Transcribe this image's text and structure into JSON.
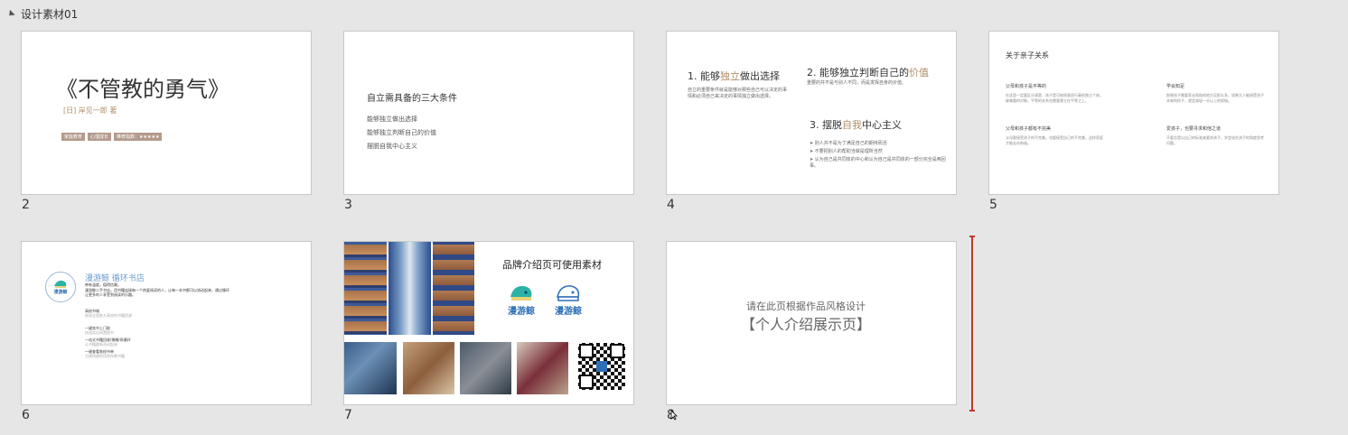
{
  "section": {
    "title": "设计素材01"
  },
  "slides": [
    {
      "number": "2",
      "title": "《不管教的勇气》",
      "author": "[日] 岸见一郎 著",
      "tags": [
        "家庭教育",
        "心理成长",
        "推荐指数：★★★★★"
      ]
    },
    {
      "number": "3",
      "title": "自立需具备的三大条件",
      "items": [
        "能够独立做出选择",
        "能够独立判断自己的价值",
        "摆脱自我中心主义"
      ]
    },
    {
      "number": "4",
      "point1": {
        "prefix": "1. 能够",
        "accent": "独立",
        "suffix": "做出选择",
        "body": "自立的重要条件就是能够对那些自己可以决定的事情和必须自己来决定的事情独立做出选择。"
      },
      "point2": {
        "prefix": "2. 能够独立判断自己的",
        "accent": "价值",
        "body": "重要的并不是与别人不同，而是发挥自身的价值。"
      },
      "point3": {
        "prefix": "3. 摆脱",
        "accent": "自我",
        "suffix": "中心主义",
        "bullets": [
          "别人并不是为了满足自己的期待而活",
          "不要把别人的帮助当做是理所当然",
          "认为自己是共同体的中心和认为自己是共同体的一部分完全是两回事。"
        ]
      }
    },
    {
      "number": "5",
      "title": "关于亲子关系",
      "blocks": [
        {
          "heading": "父母和孩子是平等的",
          "body": "在这里一定要区分清楚，孩子是可按照意愿行事的独立个体，被尊重的对象。平等的关系也需要建立在平等之上。"
        },
        {
          "heading": "学会知足",
          "body": "即便孩子需要家长帮助的地方没那么多，如果大人能接受孩子本来的样子，就会减轻一半以上的烦恼。"
        },
        {
          "heading": "父母和孩子都有不完美",
          "body": "父母要接受孩子的不完美，也要接受自己的不完美，这样家庭才能走向和谐。"
        },
        {
          "heading": "爱孩子，也要寻求和他之道",
          "body": "不要总是以自己的标准来要求孩子，学会站在孩子的角度思考问题。"
        }
      ]
    },
    {
      "number": "6",
      "logo_text": "漫游鲸",
      "title": "漫游鲸  循环书店",
      "intro": [
        "带有温度，值得信赖。",
        "漫游鲸二手书店，用书籍连接每一个热爱阅读的人，让每一本书都可以流动起来，通过循环让更多的人享受到阅读的乐趣。"
      ],
      "items": [
        {
          "heading": "高校书城",
          "detail": "收录全国各大高校的书籍资源"
        },
        {
          "heading": "一键卖书上门取",
          "detail": "快速卖出闲置图书"
        },
        {
          "heading": "一站式书籍回收/捐赠/再循环",
          "detail": "让书籍重新流动起来"
        },
        {
          "heading": "一键查看各校书单",
          "detail": "方便快捷地找到所需书籍"
        }
      ]
    },
    {
      "number": "7",
      "title": "品牌介绍页可使用素材",
      "logo_text": "漫游鲸"
    },
    {
      "number": "8",
      "subtitle": "请在此页根据作品风格设计",
      "title": "【个人介绍展示页】"
    }
  ],
  "colors": {
    "accent": "#b08d6a",
    "tag": "#b39a8c",
    "brand": "#2e6fb7",
    "brand_teal": "#2bb3a5",
    "marker": "#c0392b"
  }
}
